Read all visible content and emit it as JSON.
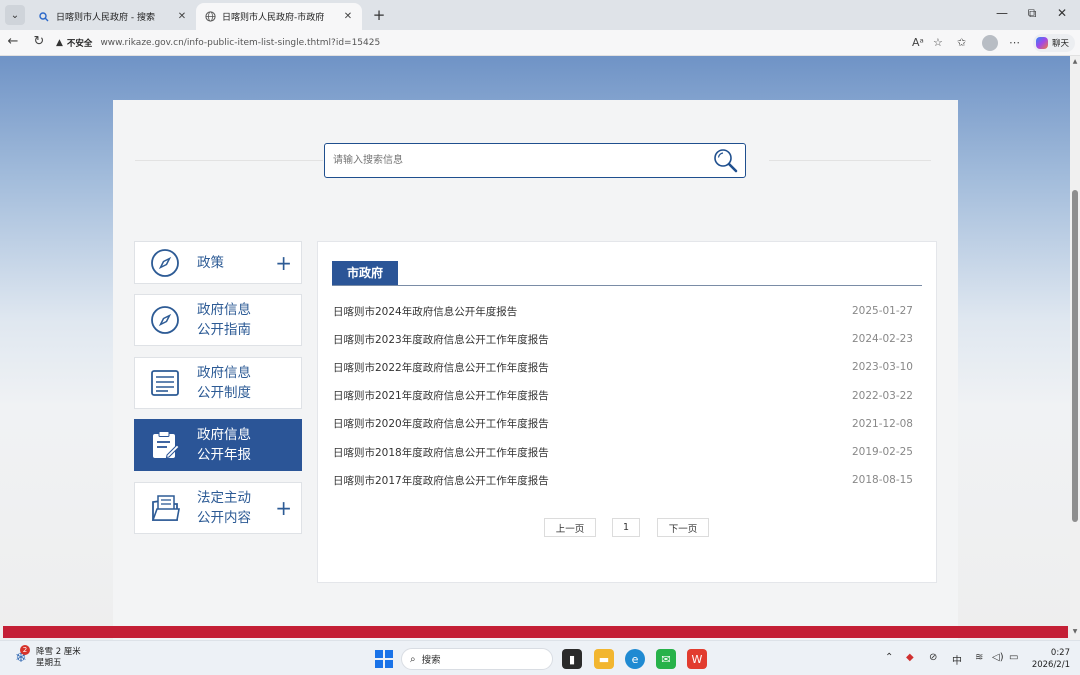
{
  "browser": {
    "tabs": [
      {
        "title": "日喀则市人民政府 - 搜索",
        "active": false
      },
      {
        "title": "日喀则市人民政府-市政府",
        "active": true
      }
    ],
    "new_tab_symbol": "+",
    "window_controls": {
      "minimize": "—",
      "maximize": "⧉",
      "close": "✕"
    },
    "address": {
      "warning_icon": "▲",
      "insecure_label": "不安全",
      "url": "www.rikaze.gov.cn/info-public-item-list-single.thtml?id=15425"
    },
    "copilot_label": "聊天"
  },
  "search": {
    "placeholder": "请输入搜索信息"
  },
  "sidebar": {
    "items": [
      {
        "line1": "政策",
        "line2": "",
        "icon": "compass-icon",
        "has_plus": true,
        "active": false
      },
      {
        "line1": "政府信息",
        "line2": "公开指南",
        "icon": "compass-icon",
        "has_plus": false,
        "active": false
      },
      {
        "line1": "政府信息",
        "line2": "公开制度",
        "icon": "list-document-icon",
        "has_plus": false,
        "active": false
      },
      {
        "line1": "政府信息",
        "line2": "公开年报",
        "icon": "clipboard-edit-icon",
        "has_plus": false,
        "active": true
      },
      {
        "line1": "法定主动",
        "line2": "公开内容",
        "icon": "folder-document-icon",
        "has_plus": true,
        "active": false
      }
    ],
    "plus_symbol": "+"
  },
  "panel": {
    "tab_label": "市政府",
    "items": [
      {
        "title": "日喀则市2024年政府信息公开年度报告",
        "date": "2025-01-27"
      },
      {
        "title": "日喀则市2023年度政府信息公开工作年度报告",
        "date": "2024-02-23"
      },
      {
        "title": "日喀则市2022年度政府信息公开工作年度报告",
        "date": "2023-03-10"
      },
      {
        "title": "日喀则市2021年度政府信息公开工作年度报告",
        "date": "2022-03-22"
      },
      {
        "title": "日喀则市2020年度政府信息公开工作年度报告",
        "date": "2021-12-08"
      },
      {
        "title": "日喀则市2018年度政府信息公开工作年度报告",
        "date": "2019-02-25"
      },
      {
        "title": "日喀则市2017年度政府信息公开工作年度报告",
        "date": "2018-08-15"
      }
    ],
    "pager": {
      "prev": "上一页",
      "page": "1",
      "next": "下一页"
    }
  },
  "taskbar": {
    "weather_badge": "2",
    "weather_line1": "降雪 2 厘米",
    "weather_line2": "星期五",
    "search_label": "搜索",
    "input_method": "中",
    "time": "0:27",
    "date": "2026/2/1"
  },
  "colors": {
    "accent": "#2b5597",
    "red_band": "#c41f35"
  }
}
